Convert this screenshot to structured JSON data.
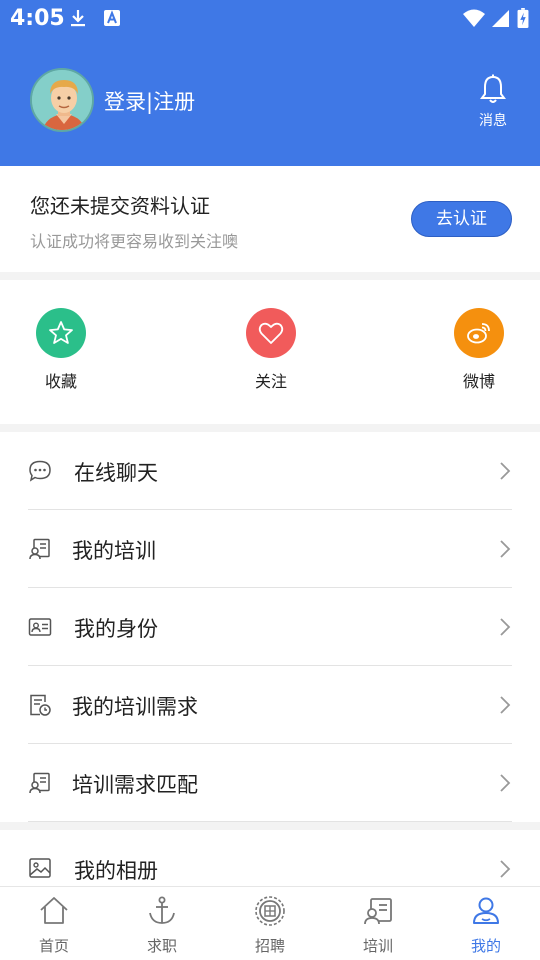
{
  "status_bar": {
    "time": "4:05"
  },
  "header": {
    "login_label": "登录|注册",
    "messages_label": "消息"
  },
  "verify": {
    "title": "您还未提交资料认证",
    "subtitle": "认证成功将更容易收到关注噢",
    "button": "去认证"
  },
  "quick_actions": [
    {
      "label": "收藏",
      "icon": "star-icon",
      "color": "#2bbf8a"
    },
    {
      "label": "关注",
      "icon": "heart-icon",
      "color": "#f15b5b"
    },
    {
      "label": "微博",
      "icon": "weibo-icon",
      "color": "#f5900e"
    }
  ],
  "menu": [
    {
      "label": "在线聊天",
      "icon": "chat-icon"
    },
    {
      "label": "我的培训",
      "icon": "training-icon"
    },
    {
      "label": "我的身份",
      "icon": "id-card-icon"
    },
    {
      "label": "我的培训需求",
      "icon": "document-clock-icon"
    },
    {
      "label": "培训需求匹配",
      "icon": "training-match-icon"
    },
    {
      "label": "我的相册",
      "icon": "image-icon"
    }
  ],
  "bottom_nav": [
    {
      "label": "首页",
      "icon": "home-icon"
    },
    {
      "label": "求职",
      "icon": "anchor-icon"
    },
    {
      "label": "招聘",
      "icon": "recruit-icon"
    },
    {
      "label": "培训",
      "icon": "training-icon"
    },
    {
      "label": "我的",
      "icon": "user-icon",
      "active": true
    }
  ],
  "colors": {
    "accent": "#3f78e6"
  }
}
